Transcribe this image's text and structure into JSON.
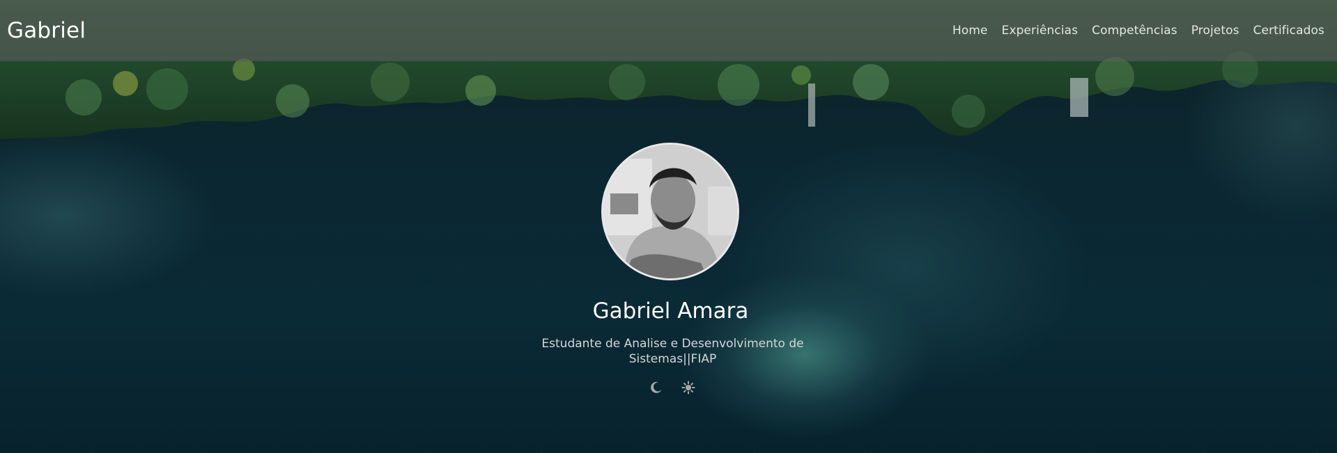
{
  "navbar": {
    "brand": "Gabriel",
    "links": [
      {
        "label": "Home"
      },
      {
        "label": "Experiências"
      },
      {
        "label": "Competências"
      },
      {
        "label": "Projetos"
      },
      {
        "label": "Certificados"
      }
    ]
  },
  "profile": {
    "name": "Gabriel Amara",
    "subtitle": "Estudante de Analise e Desenvolvimento de Sistemas||FIAP",
    "theme_toggles": [
      {
        "icon": "moon-icon"
      },
      {
        "icon": "sun-icon"
      }
    ]
  },
  "colors": {
    "navbar_bg": "#5c5c5c",
    "water": "#0b2731",
    "forest": "#1f4a2e",
    "text": "#ffffff"
  }
}
